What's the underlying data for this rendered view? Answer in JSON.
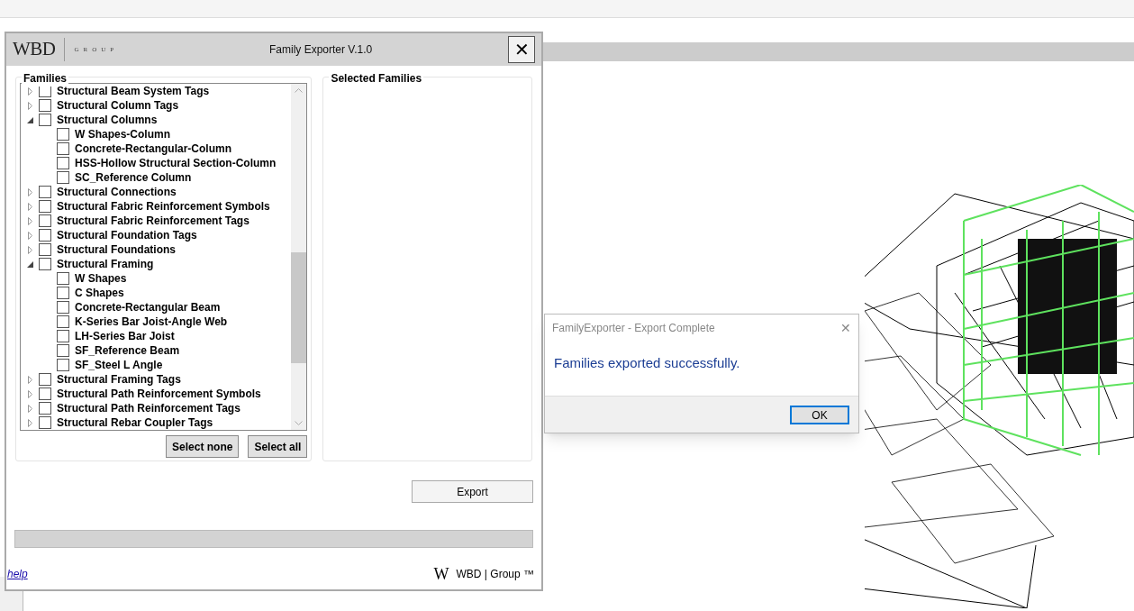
{
  "main_window": {
    "logo": "WBD",
    "logo_sub": "GROUP",
    "title": "Family Exporter V.1.0",
    "close": "✕"
  },
  "families": {
    "title": "Families",
    "items": [
      {
        "label": "Structural Beam System Tags",
        "checked": false,
        "expanded": false
      },
      {
        "label": "Structural Column Tags",
        "checked": false,
        "expanded": false
      },
      {
        "label": "Structural Columns",
        "checked": false,
        "expanded": true,
        "children": [
          {
            "label": "W Shapes-Column",
            "checked": false
          },
          {
            "label": "Concrete-Rectangular-Column",
            "checked": false
          },
          {
            "label": "HSS-Hollow Structural Section-Column",
            "checked": false
          },
          {
            "label": "SC_Reference Column",
            "checked": false
          }
        ]
      },
      {
        "label": "Structural Connections",
        "checked": false,
        "expanded": false
      },
      {
        "label": "Structural Fabric Reinforcement Symbols",
        "checked": false,
        "expanded": false
      },
      {
        "label": "Structural Fabric Reinforcement Tags",
        "checked": false,
        "expanded": false
      },
      {
        "label": "Structural Foundation Tags",
        "checked": false,
        "expanded": false
      },
      {
        "label": "Structural Foundations",
        "checked": false,
        "expanded": false
      },
      {
        "label": "Structural Framing",
        "checked": false,
        "expanded": true,
        "children": [
          {
            "label": "W Shapes",
            "checked": false
          },
          {
            "label": "C Shapes",
            "checked": false
          },
          {
            "label": "Concrete-Rectangular Beam",
            "checked": false
          },
          {
            "label": "K-Series Bar Joist-Angle Web",
            "checked": false
          },
          {
            "label": "LH-Series Bar Joist",
            "checked": false
          },
          {
            "label": "SF_Reference Beam",
            "checked": false
          },
          {
            "label": "SF_Steel L Angle",
            "checked": false
          }
        ]
      },
      {
        "label": "Structural Framing Tags",
        "checked": false,
        "expanded": false
      },
      {
        "label": "Structural Path Reinforcement Symbols",
        "checked": false,
        "expanded": false
      },
      {
        "label": "Structural Path Reinforcement Tags",
        "checked": false,
        "expanded": false
      },
      {
        "label": "Structural Rebar Coupler Tags",
        "checked": false,
        "expanded": false
      }
    ],
    "buttons": [
      "Select none",
      "Select all"
    ]
  },
  "selected_families": {
    "title": "Selected Families"
  },
  "export_button": "Export",
  "progress": {
    "level": 0
  },
  "help_link": "help",
  "footer": {
    "logo": "W",
    "text": "WBD | Group ™"
  },
  "message_box": {
    "title": "FamilyExporter - Export Complete",
    "close": "✕",
    "message": "Families exported successfully.",
    "button": "OK"
  }
}
